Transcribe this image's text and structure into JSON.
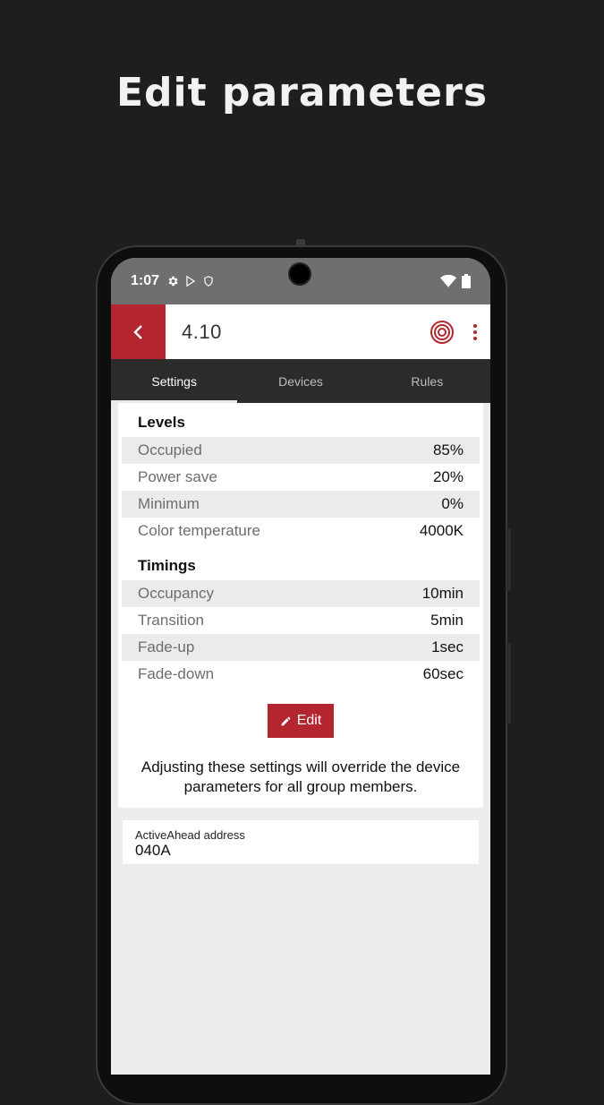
{
  "headline": "Edit parameters",
  "status_bar": {
    "time": "1:07"
  },
  "app_bar": {
    "title": "4.10"
  },
  "tabs": [
    {
      "label": "Settings",
      "active": true
    },
    {
      "label": "Devices",
      "active": false
    },
    {
      "label": "Rules",
      "active": false
    }
  ],
  "levels": {
    "title": "Levels",
    "rows": [
      {
        "label": "Occupied",
        "value": "85%"
      },
      {
        "label": "Power save",
        "value": "20%"
      },
      {
        "label": "Minimum",
        "value": "0%"
      },
      {
        "label": "Color temperature",
        "value": "4000K"
      }
    ]
  },
  "timings": {
    "title": "Timings",
    "rows": [
      {
        "label": "Occupancy",
        "value": "10min"
      },
      {
        "label": "Transition",
        "value": "5min"
      },
      {
        "label": "Fade-up",
        "value": "1sec"
      },
      {
        "label": "Fade-down",
        "value": "60sec"
      }
    ]
  },
  "edit_button": {
    "label": "Edit"
  },
  "note": "Adjusting these settings will override the device parameters for all group members.",
  "address": {
    "label": "ActiveAhead address",
    "value": "040A"
  },
  "colors": {
    "accent": "#b3262f",
    "tab_bar": "#2b2b2b",
    "status_bar": "#6f6f6f"
  }
}
